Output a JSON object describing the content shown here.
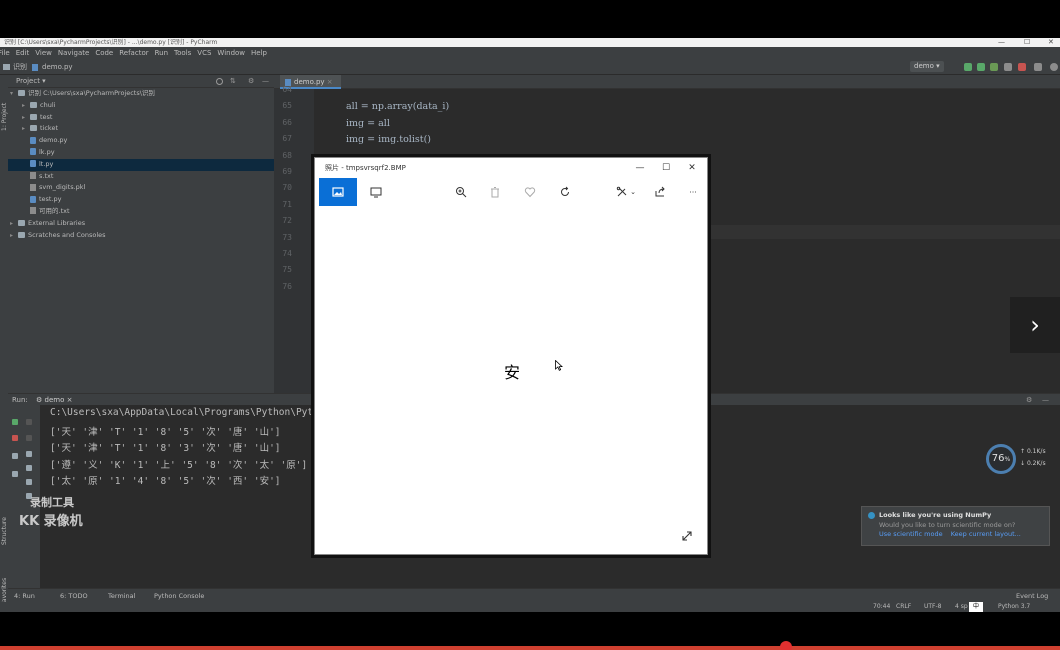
{
  "ide": {
    "title": "识别 [C:\\Users\\sxa\\PycharmProjects\\识别] - ...\\demo.py [识别] - PyCharm",
    "menu": [
      "File",
      "Edit",
      "View",
      "Navigate",
      "Code",
      "Refactor",
      "Run",
      "Tools",
      "VCS",
      "Window",
      "Help"
    ],
    "breadcrumb": [
      "识别",
      "demo.py"
    ],
    "run_config": "demo",
    "project_header": "Project",
    "project_tree": [
      {
        "label": "识别  C:\\Users\\sxa\\PycharmProjects\\识别",
        "kind": "folder",
        "indent": 0,
        "open": true
      },
      {
        "label": "chuli",
        "kind": "folder",
        "indent": 1
      },
      {
        "label": "test",
        "kind": "folder",
        "indent": 1
      },
      {
        "label": "ticket",
        "kind": "folder",
        "indent": 1
      },
      {
        "label": "demo.py",
        "kind": "py",
        "indent": 1
      },
      {
        "label": "lk.py",
        "kind": "py",
        "indent": 1
      },
      {
        "label": "lt.py",
        "kind": "py",
        "indent": 1,
        "selected": true
      },
      {
        "label": "s.txt",
        "kind": "txt",
        "indent": 1
      },
      {
        "label": "svm_digits.pkl",
        "kind": "txt",
        "indent": 1
      },
      {
        "label": "test.py",
        "kind": "py",
        "indent": 1
      },
      {
        "label": "可用的.txt",
        "kind": "txt",
        "indent": 1
      },
      {
        "label": "External Libraries",
        "kind": "lib",
        "indent": 0
      },
      {
        "label": "Scratches and Consoles",
        "kind": "lib",
        "indent": 0
      }
    ],
    "editor_tab": "demo.py",
    "line_numbers": [
      "64",
      "65",
      "66",
      "67",
      "68",
      "69",
      "70",
      "71",
      "72",
      "73",
      "74",
      "75",
      "76"
    ],
    "code_lines": [
      "",
      "all = np.array(data_i)",
      "img = all",
      "img = img.tolist()",
      "",
      "",
      "",
      "",
      "",
      "",
      "",
      "",
      ""
    ],
    "run_tab_label": "Run:",
    "run_config_tab": "demo",
    "console_lines": [
      "C:\\Users\\sxa\\AppData\\Local\\Programs\\Python\\Pyth",
      "['天' '津' 'T' '1' '8' '5' '次' '唐' '山']",
      "['天' '津' 'T' '1' '8' '3' '次' '唐' '山']",
      "['遵' '义' 'K' '1' '上' '5' '8' '次' '太' '原']",
      "['太' '原' '1' '4' '8' '5' '次' '西' '安']"
    ],
    "watermark": [
      "录制工具",
      "KK 录像机"
    ],
    "bottom_tabs": [
      "4: Run",
      "6: TODO",
      "Terminal",
      "Python Console"
    ],
    "event_log": "Event Log",
    "status": {
      "position": "70:44",
      "line_sep": "CRLF",
      "encoding": "UTF-8",
      "indent": "4 sp",
      "ime": "中",
      "interpreter": "Python 3.7"
    },
    "notification": {
      "title": "Looks like you're using NumPy",
      "body": "Would you like to turn scientific mode on?",
      "link1": "Use scientific mode",
      "link2": "Keep current layout..."
    },
    "side_labels": [
      "1: Project",
      "Structure",
      "Favorites"
    ]
  },
  "meter": {
    "percent": "76",
    "unit": "%",
    "up": "0.1",
    "down": "0.2",
    "rate_unit": "K/s"
  },
  "photos": {
    "title": "照片 - tmpsvrsqrf2.BMP",
    "image_text": "安",
    "minimize": "—",
    "maximize": "☐",
    "close": "✕",
    "more": "···"
  },
  "nav": {
    "next": "›"
  }
}
